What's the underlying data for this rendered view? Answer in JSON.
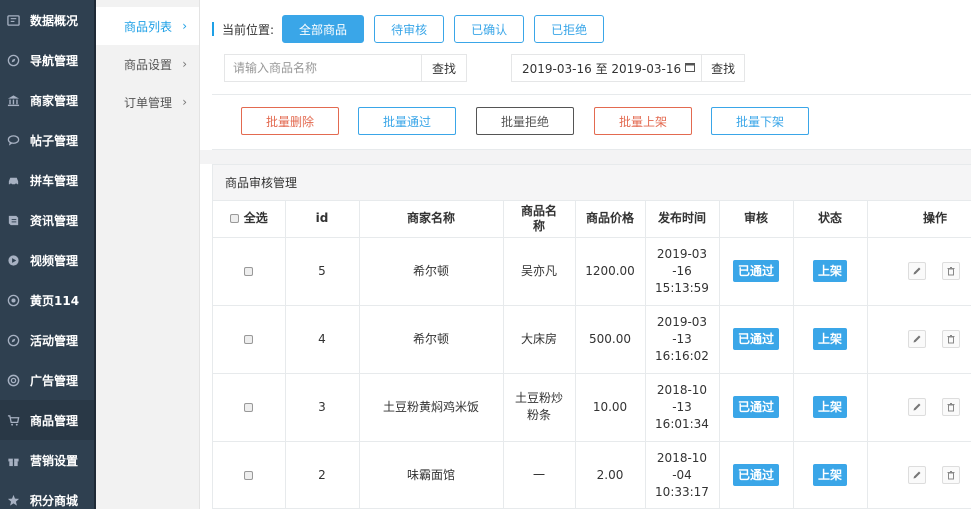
{
  "sidebar": {
    "items": [
      {
        "label": "数据概况",
        "icon": "dashboard-icon"
      },
      {
        "label": "导航管理",
        "icon": "compass-icon"
      },
      {
        "label": "商家管理",
        "icon": "bank-icon"
      },
      {
        "label": "帖子管理",
        "icon": "comment-icon"
      },
      {
        "label": "拼车管理",
        "icon": "car-icon"
      },
      {
        "label": "资讯管理",
        "icon": "book-icon"
      },
      {
        "label": "视频管理",
        "icon": "play-circle-icon"
      },
      {
        "label": "黄页114",
        "icon": "circle-icon"
      },
      {
        "label": "活动管理",
        "icon": "compass-icon"
      },
      {
        "label": "广告管理",
        "icon": "lifebuoy-icon"
      },
      {
        "label": "商品管理",
        "icon": "cart-icon"
      },
      {
        "label": "营销设置",
        "icon": "gift-icon"
      },
      {
        "label": "积分商城",
        "icon": "star-icon"
      }
    ]
  },
  "subsidebar": {
    "items": [
      {
        "label": "商品列表"
      },
      {
        "label": "商品设置"
      },
      {
        "label": "订单管理"
      }
    ]
  },
  "breadcrumb": {
    "label": "当前位置:",
    "tabs": [
      "全部商品",
      "待审核",
      "已确认",
      "已拒绝"
    ]
  },
  "search": {
    "placeholder": "请输入商品名称",
    "find_label": "查找",
    "date_range": "2019-03-16 至 2019-03-16",
    "date_find_label": "查找"
  },
  "actions": {
    "batch_delete": "批量删除",
    "batch_approve": "批量通过",
    "batch_reject": "批量拒绝",
    "batch_onsale": "批量上架",
    "batch_offsale": "批量下架"
  },
  "table": {
    "title": "商品审核管理",
    "headers": {
      "select_all": "全选",
      "id": "id",
      "merchant": "商家名称",
      "product": "商品名称",
      "price": "商品价格",
      "published": "发布时间",
      "audit": "审核",
      "status": "状态",
      "ops": "操作"
    },
    "rows": [
      {
        "id": "5",
        "merchant": "希尔顿",
        "product": "吴亦凡",
        "price": "1200.00",
        "date": "2019-03-16",
        "time": "15:13:59",
        "audit": "已通过",
        "status": "上架"
      },
      {
        "id": "4",
        "merchant": "希尔顿",
        "product": "大床房",
        "price": "500.00",
        "date": "2019-03-13",
        "time": "16:16:02",
        "audit": "已通过",
        "status": "上架"
      },
      {
        "id": "3",
        "merchant": "土豆粉黄焖鸡米饭",
        "product": "土豆粉炒粉条",
        "price": "10.00",
        "date": "2018-10-13",
        "time": "16:01:34",
        "audit": "已通过",
        "status": "上架"
      },
      {
        "id": "2",
        "merchant": "味霸面馆",
        "product": "一",
        "price": "2.00",
        "date": "2018-10-04",
        "time": "10:33:17",
        "audit": "已通过",
        "status": "上架"
      }
    ]
  },
  "colors": {
    "sidebar_bg": "#2f4050",
    "accent": "#3aa6e8",
    "danger": "#e36a50"
  }
}
